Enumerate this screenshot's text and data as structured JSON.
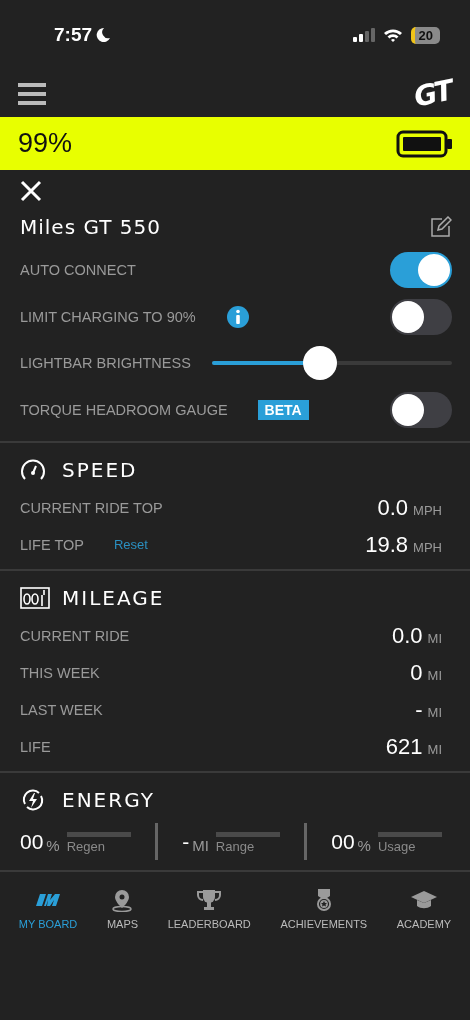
{
  "status_bar": {
    "time": "7:57",
    "battery": "20"
  },
  "header": {
    "logo": "GT"
  },
  "battery_banner": {
    "percent": "99%"
  },
  "device": {
    "name": "Miles GT 550"
  },
  "settings": [
    {
      "kind": "toggle",
      "label": "AUTO CONNECT",
      "on": true
    },
    {
      "kind": "toggle",
      "label": "LIMIT CHARGING TO 90%",
      "on": false,
      "info": true
    },
    {
      "kind": "slider",
      "label": "LIGHTBAR BRIGHTNESS",
      "level": 0.45
    },
    {
      "kind": "toggle",
      "label": "TORQUE HEADROOM GAUGE",
      "on": false,
      "badge": "BETA"
    }
  ],
  "sections": [
    {
      "kind": "speed",
      "title": "SPEED",
      "rows": [
        {
          "label": "CURRENT RIDE TOP",
          "value": "0.0",
          "unit": "MPH"
        },
        {
          "label": "LIFE TOP",
          "link": "Reset",
          "value": "19.8",
          "unit": "MPH"
        }
      ]
    },
    {
      "kind": "mileage",
      "title": "MILEAGE",
      "rows": [
        {
          "label": "CURRENT RIDE",
          "value": "0.0",
          "unit": "MI"
        },
        {
          "label": "THIS WEEK",
          "value": "0",
          "unit": "MI"
        },
        {
          "label": "LAST WEEK",
          "value": "-",
          "unit": "MI"
        },
        {
          "label": "LIFE",
          "value": "621",
          "unit": "MI"
        }
      ]
    }
  ],
  "energy": {
    "title": "ENERGY",
    "stats": [
      {
        "value": "00",
        "unit": "%",
        "label": "Regen"
      },
      {
        "value": "-",
        "unit": "MI",
        "label": "Range"
      },
      {
        "value": "00",
        "unit": "%",
        "label": "Usage"
      }
    ]
  },
  "nav": [
    {
      "kind": "board",
      "label": "MY BOARD",
      "selected": true
    },
    {
      "kind": "map",
      "label": "MAPS",
      "selected": false
    },
    {
      "kind": "trophy",
      "label": "LEADERBOARD",
      "selected": false
    },
    {
      "kind": "medal",
      "label": "ACHIEVEMENTS",
      "selected": false
    },
    {
      "kind": "cap",
      "label": "ACADEMY",
      "selected": false
    }
  ]
}
